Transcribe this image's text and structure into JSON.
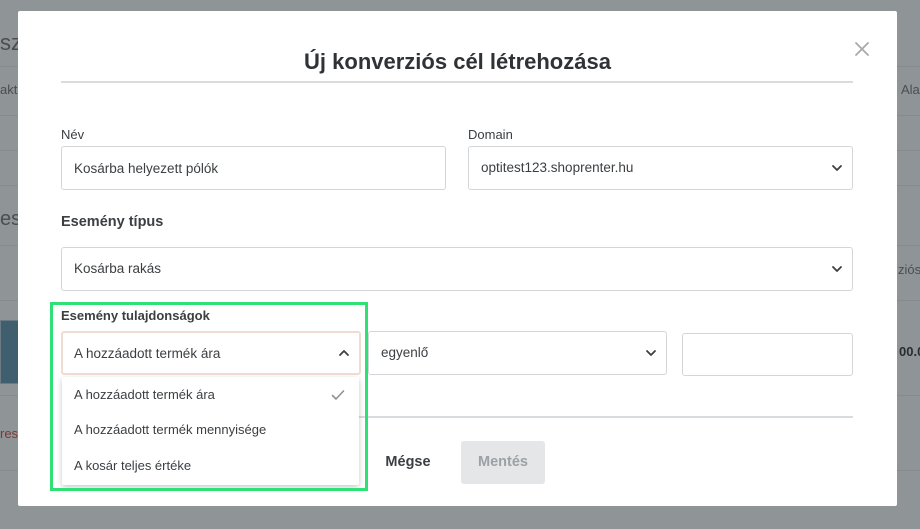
{
  "modal": {
    "title": "Új konverziós cél létrehozása",
    "close_icon": "close-icon"
  },
  "form": {
    "name": {
      "label": "Név",
      "value": "Kosárba helyezett pólók"
    },
    "domain": {
      "label": "Domain",
      "value": "optitest123.shoprenter.hu"
    },
    "event_type": {
      "label": "Esemény típus",
      "value": "Kosárba rakás"
    },
    "event_properties": {
      "label": "Esemény tulajdonságok",
      "property_select": {
        "value": "A hozzáadott termék ára",
        "open": true,
        "options": [
          {
            "label": "A hozzáadott termék ára",
            "selected": true
          },
          {
            "label": "A hozzáadott termék mennyisége",
            "selected": false
          },
          {
            "label": "A kosár teljes értéke",
            "selected": false
          }
        ]
      },
      "operator_select": {
        "value": "egyenlő"
      },
      "value_input": {
        "value": ""
      }
    }
  },
  "actions": {
    "cancel_label": "Mégse",
    "save_label": "Mentés"
  },
  "background_fragments": {
    "frag_1": "sz",
    "frag_2": "akt",
    "frag_3": "Ala",
    "frag_4": "es",
    "frag_5": "ziós",
    "frag_6": "00.0",
    "frag_7": "res"
  },
  "colors": {
    "overlay": "#8f9497",
    "modal_bg": "#ffffff",
    "text": "#3b3f42",
    "border": "#d3d6d9",
    "focus_border": "#f0dcd2",
    "highlight": "#2fe076",
    "disabled_button_bg": "#e4e6e8",
    "disabled_button_text": "#9ca1a5"
  }
}
